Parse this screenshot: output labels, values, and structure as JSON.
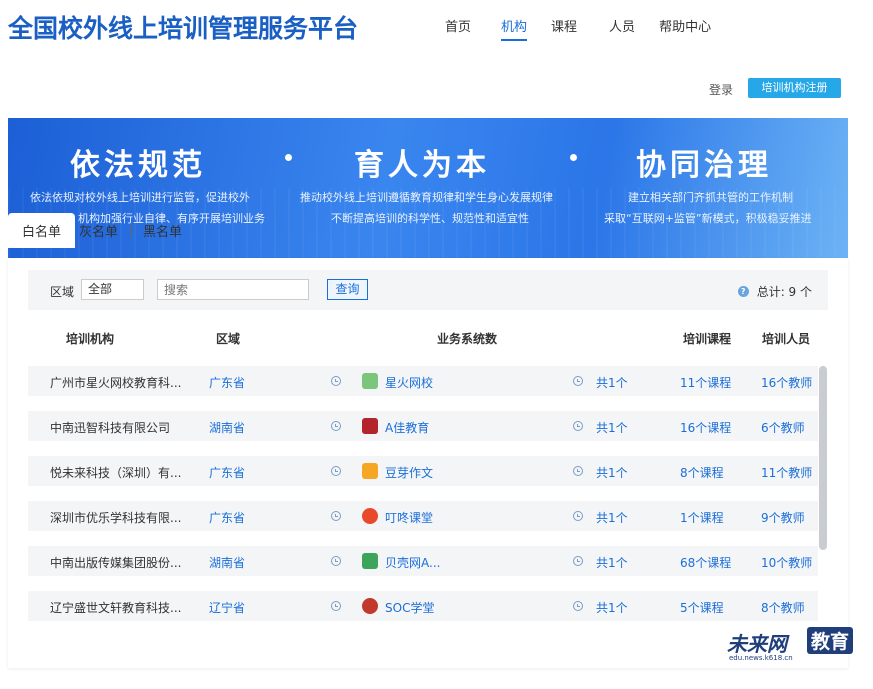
{
  "header": {
    "title": "全国校外线上培训管理服务平台",
    "nav": [
      "首页",
      "机构",
      "课程",
      "人员",
      "帮助中心"
    ],
    "active_nav": 1,
    "login_label": "登录",
    "register_label": "培训机构注册"
  },
  "banner": {
    "slogans": [
      {
        "title": "依法规范",
        "lines": [
          "依法依规对校外线上培训进行监管，促进校外",
          "机构加强行业自律、有序开展培训业务"
        ]
      },
      {
        "title": "育人为本",
        "lines": [
          "推动校外线上培训遵循教育规律和学生身心发展规律",
          "不断提高培训的科学性、规范性和适宜性"
        ]
      },
      {
        "title": "协同治理",
        "lines": [
          "建立相关部门齐抓共管的工作机制",
          "采取“互联网+监管”新模式，积极稳妥推进"
        ]
      }
    ]
  },
  "tabs": [
    "白名单",
    "灰名单",
    "黑名单"
  ],
  "filter": {
    "region_label": "区域",
    "region_value": "全部",
    "search_placeholder": "搜索",
    "query_label": "查询",
    "total_label": "总计: 9 个"
  },
  "table": {
    "headers": {
      "org": "培训机构",
      "region": "区域",
      "systems": "业务系统数",
      "courses": "培训课程",
      "staff": "培训人员"
    },
    "rows": [
      {
        "org": "广州市星火网校教育科...",
        "region": "广东省",
        "system": "星火网校",
        "count": "共1个",
        "courses": "11个课程",
        "teachers": "16个教师",
        "logo_color": "#7bc67b"
      },
      {
        "org": "中南迅智科技有限公司",
        "region": "湖南省",
        "system": "A佳教育",
        "count": "共1个",
        "courses": "16个课程",
        "teachers": "6个教师",
        "logo_color": "#b3242b"
      },
      {
        "org": "悦未来科技（深圳）有...",
        "region": "广东省",
        "system": "豆芽作文",
        "count": "共1个",
        "courses": "8个课程",
        "teachers": "11个教师",
        "logo_color": "#f5a623"
      },
      {
        "org": "深圳市优乐学科技有限...",
        "region": "广东省",
        "system": "叮咚课堂",
        "count": "共1个",
        "courses": "1个课程",
        "teachers": "9个教师",
        "logo_color": "#e8492a"
      },
      {
        "org": "中南出版传媒集团股份...",
        "region": "湖南省",
        "system": "贝壳网A...",
        "count": "共1个",
        "courses": "68个课程",
        "teachers": "10个教师",
        "logo_color": "#3aa55b"
      },
      {
        "org": "辽宁盛世文轩教育科技...",
        "region": "辽宁省",
        "system": "SOC学堂",
        "count": "共1个",
        "courses": "5个课程",
        "teachers": "8个教师",
        "logo_color": "#c0392b"
      }
    ]
  },
  "watermark": {
    "main": "未来网",
    "box": "教育",
    "url": "edu.news.k618.cn"
  }
}
